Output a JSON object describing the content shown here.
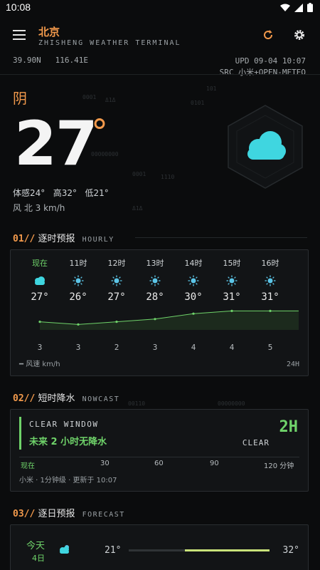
{
  "status": {
    "time": "10:08"
  },
  "header": {
    "city": "北京",
    "subtitle": "ZHISHENG WEATHER TERMINAL"
  },
  "meta": {
    "lat": "39.90N",
    "lon": "116.41E",
    "updated": "UPD 09-04 10:07",
    "source": "SRC 小米+OPEN-METEO"
  },
  "current": {
    "condition": "阴",
    "temp": "27",
    "degree": "°",
    "feels": "体感24°",
    "high": "高32°",
    "low": "低21°",
    "wind": "风 北 3 km/h",
    "icon": "cloud-icon"
  },
  "bg_codes": [
    "0001",
    "0101",
    "Δ1Δ",
    "00000000",
    "1110",
    "0001",
    "Δ1Δ",
    "101",
    "00110",
    "00000000"
  ],
  "sections": {
    "hourly": {
      "num": "01//",
      "title": "逐时预报",
      "en": "HOURLY"
    },
    "nowcast": {
      "num": "02//",
      "title": "短时降水",
      "en": "NOWCAST"
    },
    "forecast": {
      "num": "03//",
      "title": "逐日预报",
      "en": "FORECAST"
    }
  },
  "hourly": {
    "items": [
      {
        "label": "现在",
        "icon": "cloud-icon",
        "temp": "27°",
        "wind": "3"
      },
      {
        "label": "11时",
        "icon": "sun-icon",
        "temp": "26°",
        "wind": "3"
      },
      {
        "label": "12时",
        "icon": "sun-icon",
        "temp": "27°",
        "wind": "2"
      },
      {
        "label": "13时",
        "icon": "sun-icon",
        "temp": "28°",
        "wind": "3"
      },
      {
        "label": "14时",
        "icon": "sun-icon",
        "temp": "30°",
        "wind": "4"
      },
      {
        "label": "15时",
        "icon": "sun-icon",
        "temp": "31°",
        "wind": "4"
      },
      {
        "label": "16时",
        "icon": "sun-icon",
        "temp": "31°",
        "wind": "5"
      }
    ],
    "temps": [
      27,
      26,
      27,
      28,
      30,
      31,
      31
    ],
    "legend": "风速 km/h",
    "range": "24H"
  },
  "nowcast": {
    "title": "CLEAR WINDOW",
    "message": "未来 2 小时无降水",
    "big": "2H",
    "status": "CLEAR",
    "ticks": [
      "现在",
      "30",
      "60",
      "90",
      "120 分钟"
    ],
    "footer": "小米 · 1分钟级 · 更新于 10:07"
  },
  "forecast": {
    "day": "今天",
    "date": "4日",
    "icon": "cloud-sun-icon",
    "low": "21°",
    "high": "32°",
    "range_fraction_start": 0.4,
    "range_fraction_end": 1.0
  },
  "colors": {
    "accent": "#f39a4c",
    "green": "#6fd36a",
    "cloud": "#3fd6e0",
    "sun": "#5cc6e8"
  }
}
